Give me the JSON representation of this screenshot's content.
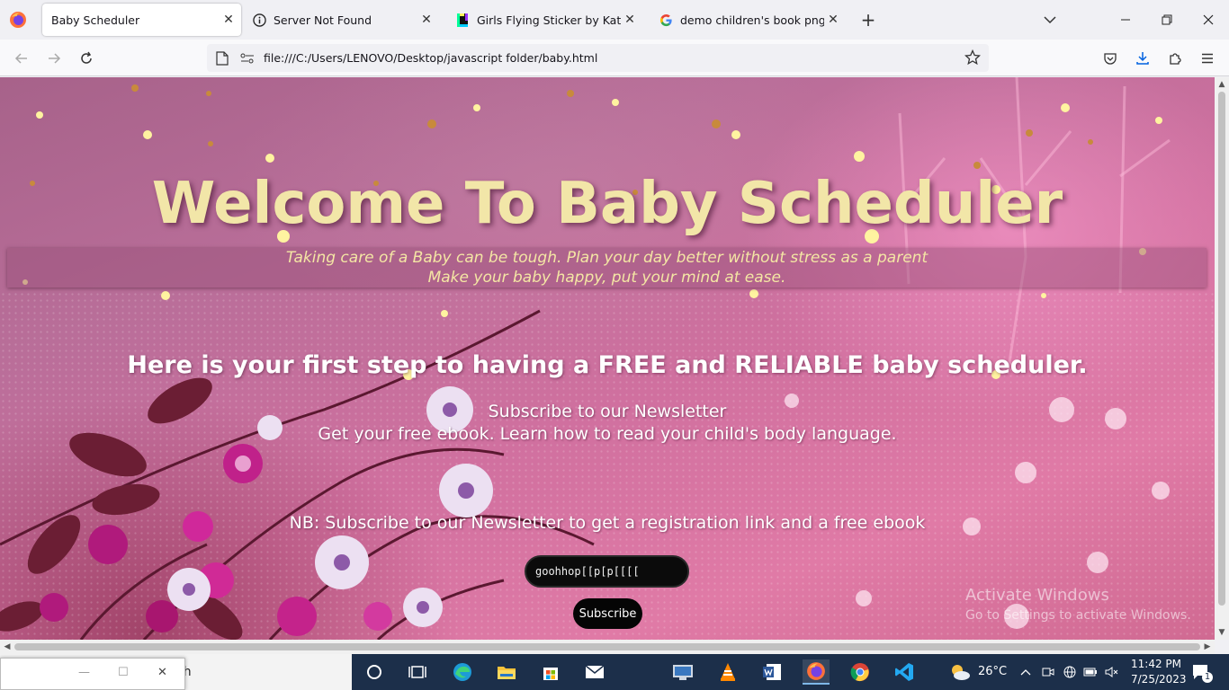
{
  "browser": {
    "tabs": [
      {
        "title": "Baby Scheduler",
        "icon": "firefox-page-icon",
        "active": true
      },
      {
        "title": "Server Not Found",
        "icon": "info-icon",
        "active": false
      },
      {
        "title": "Girls Flying Sticker by Katri Tikka",
        "icon": "giphy-icon",
        "active": false
      },
      {
        "title": "demo children's book png - Go",
        "icon": "google-icon",
        "active": false
      }
    ],
    "url": "file:///C:/Users/LENOVO/Desktop/javascript folder/baby.html"
  },
  "page": {
    "title": "Welcome To Baby Scheduler",
    "tagline_1": "Taking care of a Baby can be tough. Plan your day better without stress as a parent",
    "tagline_2": "Make your baby happy, put your mind at ease.",
    "first_step": "Here is your first step to having a FREE and RELIABLE baby scheduler.",
    "subscribe_heading": "Subscribe to our Newsletter",
    "ebook_line": "Get your free ebook. Learn how to read your child's body language.",
    "nb_line": "NB: Subscribe to our Newsletter to get a registration link and a free ebook",
    "email_value": "goohhop[[p[p[[[[",
    "subscribe_button": "Subscribe"
  },
  "watermark": {
    "line1": "Activate Windows",
    "line2": "Go to Settings to activate Windows."
  },
  "taskbar": {
    "search_text": "ch",
    "weather": "26°C",
    "time": "11:42 PM",
    "date": "7/25/2023",
    "notification_count": "1"
  },
  "colors": {
    "title_gold": "#f2e6a8",
    "taskbar_bg": "#1c2f4a",
    "button_black": "#050505"
  }
}
